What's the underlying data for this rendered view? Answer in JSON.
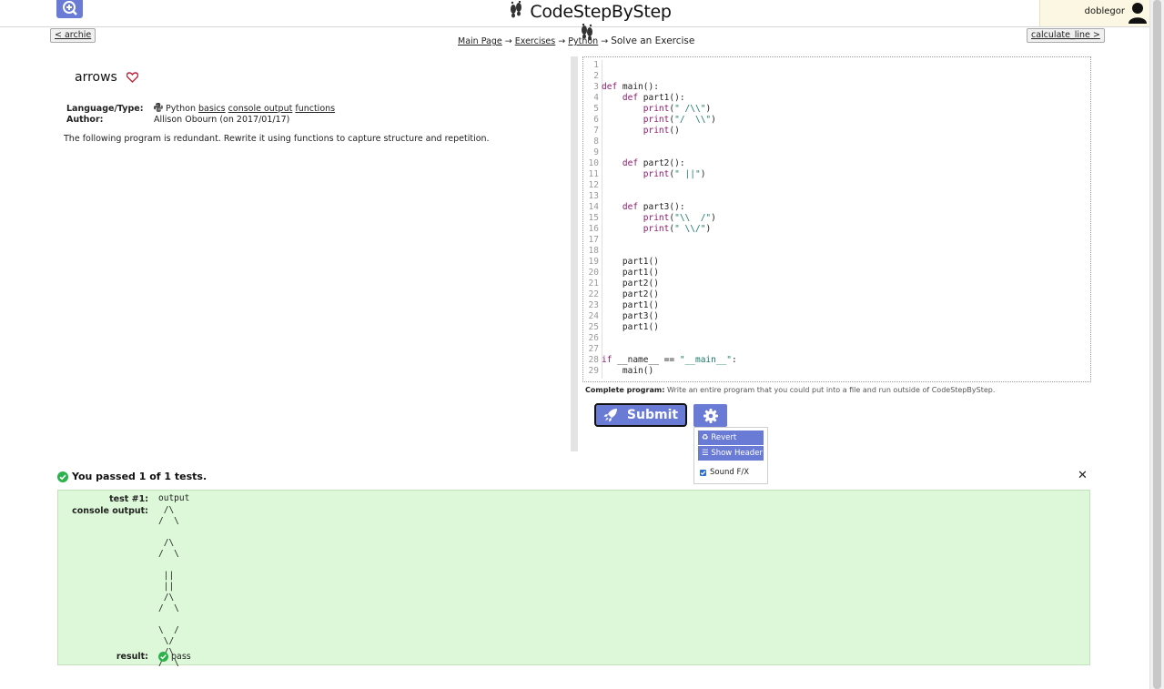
{
  "header": {
    "site_title": "CodeStepByStep",
    "username": "doblegor"
  },
  "nav": {
    "prev_label": "< archie",
    "next_label": "calculate_line >",
    "breadcrumb": [
      "Main Page",
      "Exercises",
      "Python"
    ],
    "breadcrumb_current": "Solve an Exercise",
    "sep": "→"
  },
  "problem": {
    "title": "arrows",
    "language_label": "Language/Type:",
    "language": "Python",
    "tags": [
      "basics",
      "console output",
      "functions"
    ],
    "author_label": "Author:",
    "author": "Allison Obourn (on 2017/01/17)",
    "description": "The following program is redundant. Rewrite it using functions to capture structure and repetition."
  },
  "editor": {
    "lines": [
      "",
      "",
      "def main():",
      "    def part1():",
      "        print(\" /\\\\\")",
      "        print(\"/  \\\\\")",
      "        print()",
      "",
      "",
      "    def part2():",
      "        print(\" ||\")",
      "",
      "",
      "    def part3():",
      "        print(\"\\\\  /\")",
      "        print(\" \\\\/\")",
      "",
      "",
      "    part1()",
      "    part1()",
      "    part2()",
      "    part2()",
      "    part1()",
      "    part3()",
      "    part1()",
      "",
      "",
      "if __name__ == \"__main__\":",
      "    main()"
    ],
    "line_numbers": [
      "1",
      "2",
      "3",
      "4",
      "5",
      "6",
      "7",
      "8",
      "9",
      "10",
      "11",
      "12",
      "13",
      "14",
      "15",
      "16",
      "17",
      "18",
      "19",
      "20",
      "21",
      "22",
      "23",
      "24",
      "25",
      "26",
      "27",
      "28",
      "29"
    ]
  },
  "program_note": {
    "label": "Complete program:",
    "text": "Write an entire program that you could put into a file and run outside of CodeStepByStep."
  },
  "actions": {
    "submit_label": "Submit",
    "revert_label": "Revert",
    "show_header_label": "Show Header",
    "sound_label": "Sound F/X",
    "sound_checked": true
  },
  "results": {
    "summary": "You passed 1 of 1 tests.",
    "test_label": "test #1:",
    "test_value": "output",
    "console_label": "console output:",
    "console_output": " /\\\n/  \\\n\n /\\\n/  \\\n\n ||\n ||\n /\\\n/  \\\n\n\\  /\n \\/\n /\\\n/  \\",
    "result_label": "result:",
    "result_value": "pass"
  },
  "colors": {
    "accent": "#6a7bd6",
    "pass_bg": "#dcf8d8",
    "pass_icon": "#2bb24c",
    "keyword": "#8a1a6a",
    "string": "#1a7a6a"
  }
}
